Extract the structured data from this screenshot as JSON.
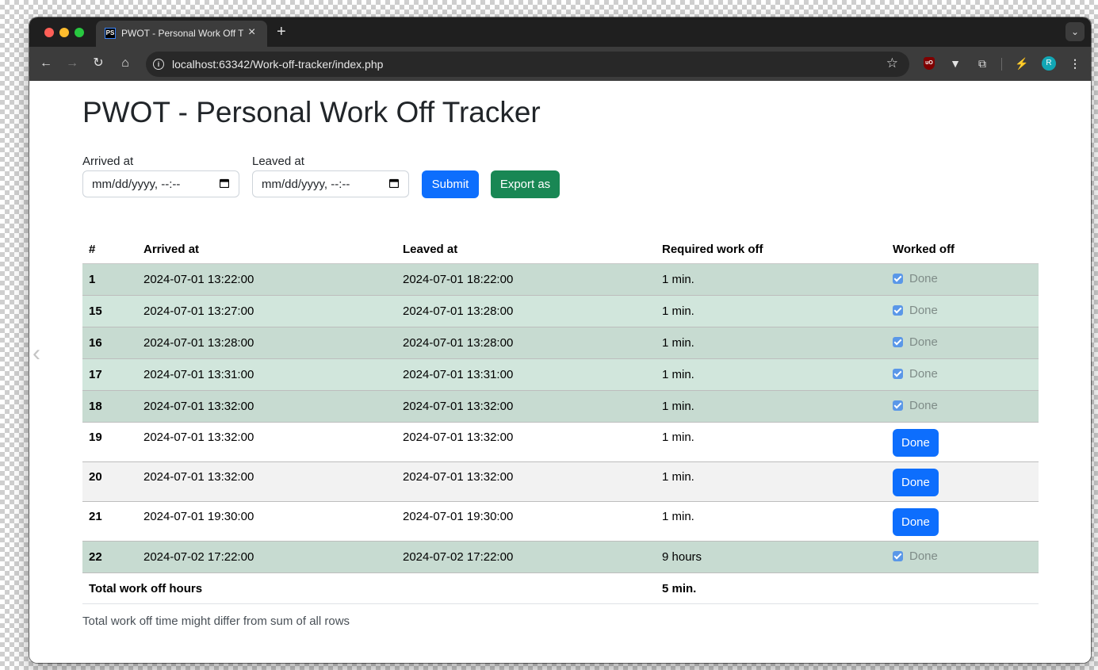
{
  "browser": {
    "tab": {
      "favicon": "PS",
      "title": "PWOT - Personal Work Off Tracker"
    },
    "url": "localhost:63342/Work-off-tracker/index.php",
    "avatar_letter": "R",
    "ublock_label": "uO"
  },
  "page": {
    "title": "PWOT - Personal Work Off Tracker",
    "form": {
      "arrived_label": "Arrived at",
      "leaved_label": "Leaved at",
      "date_placeholder": "mm/dd/yyyy, --:--",
      "submit_label": "Submit",
      "export_label": "Export as"
    },
    "table": {
      "headers": [
        "#",
        "Arrived at",
        "Leaved at",
        "Required work off",
        "Worked off"
      ],
      "rows": [
        {
          "id": "1",
          "arrived": "2024-07-01 13:22:00",
          "leaved": "2024-07-01 18:22:00",
          "required": "1 min.",
          "worked": "Done"
        },
        {
          "id": "15",
          "arrived": "2024-07-01 13:27:00",
          "leaved": "2024-07-01 13:28:00",
          "required": "1 min.",
          "worked": "Done"
        },
        {
          "id": "16",
          "arrived": "2024-07-01 13:28:00",
          "leaved": "2024-07-01 13:28:00",
          "required": "1 min.",
          "worked": "Done"
        },
        {
          "id": "17",
          "arrived": "2024-07-01 13:31:00",
          "leaved": "2024-07-01 13:31:00",
          "required": "1 min.",
          "worked": "Done"
        },
        {
          "id": "18",
          "arrived": "2024-07-01 13:32:00",
          "leaved": "2024-07-01 13:32:00",
          "required": "1 min.",
          "worked": "Done"
        },
        {
          "id": "19",
          "arrived": "2024-07-01 13:32:00",
          "leaved": "2024-07-01 13:32:00",
          "required": "1 min.",
          "worked": "Done"
        },
        {
          "id": "20",
          "arrived": "2024-07-01 13:32:00",
          "leaved": "2024-07-01 13:32:00",
          "required": "1 min.",
          "worked": "Done"
        },
        {
          "id": "21",
          "arrived": "2024-07-01 19:30:00",
          "leaved": "2024-07-01 19:30:00",
          "required": "1 min.",
          "worked": "Done"
        },
        {
          "id": "22",
          "arrived": "2024-07-02 17:22:00",
          "leaved": "2024-07-02 17:22:00",
          "required": "9 hours",
          "worked": "Done"
        }
      ],
      "total_label": "Total work off hours",
      "total_value": "5 min."
    },
    "footnote": "Total work off time might differ from sum of all rows"
  },
  "colors": {
    "primary": "#0d6efd",
    "success": "#198754",
    "done_row_a": "#c7dbd1",
    "done_row_b": "#d1e6dc",
    "chrome_dark": "#1f1f1f"
  }
}
